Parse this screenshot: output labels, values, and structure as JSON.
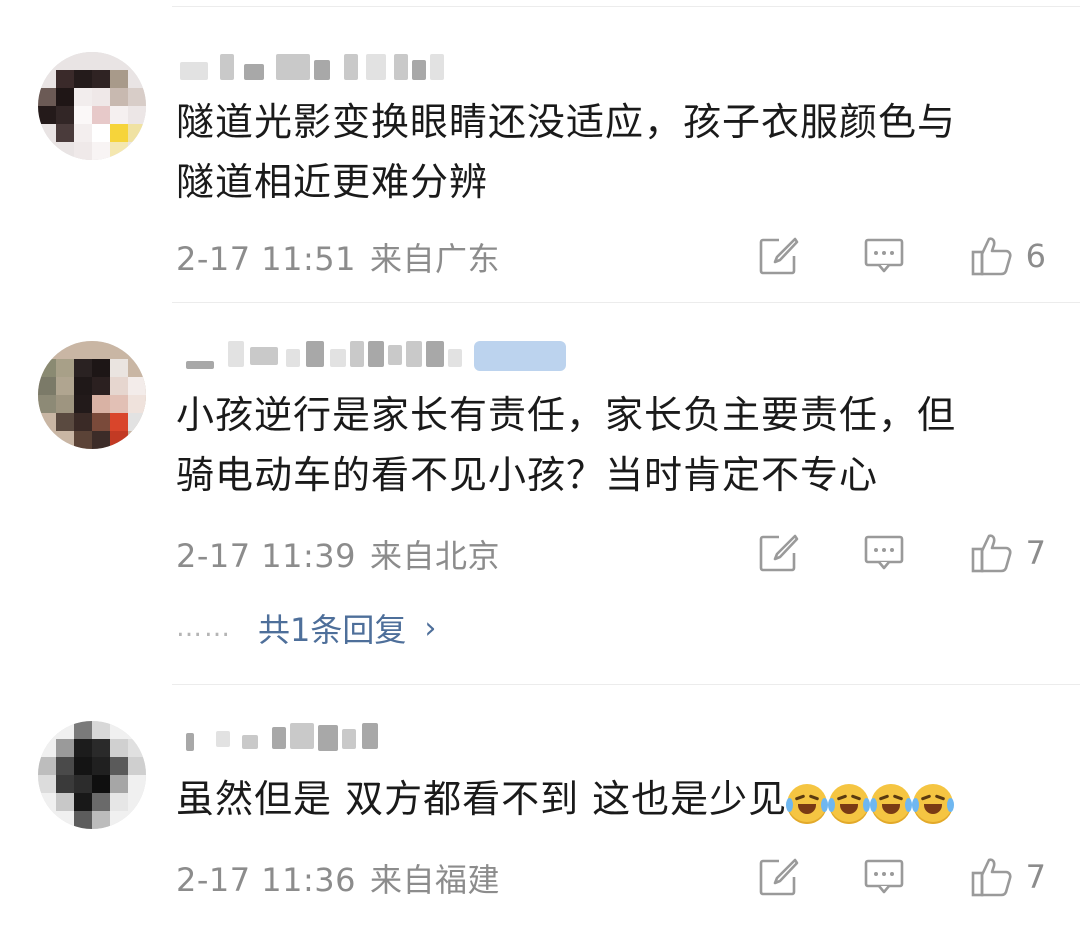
{
  "comments": [
    {
      "text_line1": "隧道光影变换眼睛还没适应，孩子衣服颜色与",
      "text_line2": "隧道相近更难分辨",
      "time": "2-17 11:51",
      "location": "来自广东",
      "likes": "6"
    },
    {
      "text_line1": "小孩逆行是家长有责任，家长负主要责任，但",
      "text_line2": "骑电动车的看不见小孩？当时肯定不专心",
      "time": "2-17 11:39",
      "location": "来自北京",
      "likes": "7",
      "replies_dots": "……",
      "replies_label": "共1条回复",
      "replies_chevron": "›"
    },
    {
      "text_line1": "虽然但是 双方都看不到 这也是少见",
      "time": "2-17 11:36",
      "location": "来自福建",
      "likes": "7",
      "emoji_name": "laugh-cry-emoji",
      "emoji_count": 4
    }
  ],
  "icons": {
    "repost": "repost-icon",
    "comment": "comment-icon",
    "like": "thumbs-up-icon"
  },
  "colors": {
    "text": "#1a1a1a",
    "meta": "#8c8c8c",
    "link": "#4e6f9a",
    "divider": "#ececec",
    "icon": "#9a9a9a"
  }
}
